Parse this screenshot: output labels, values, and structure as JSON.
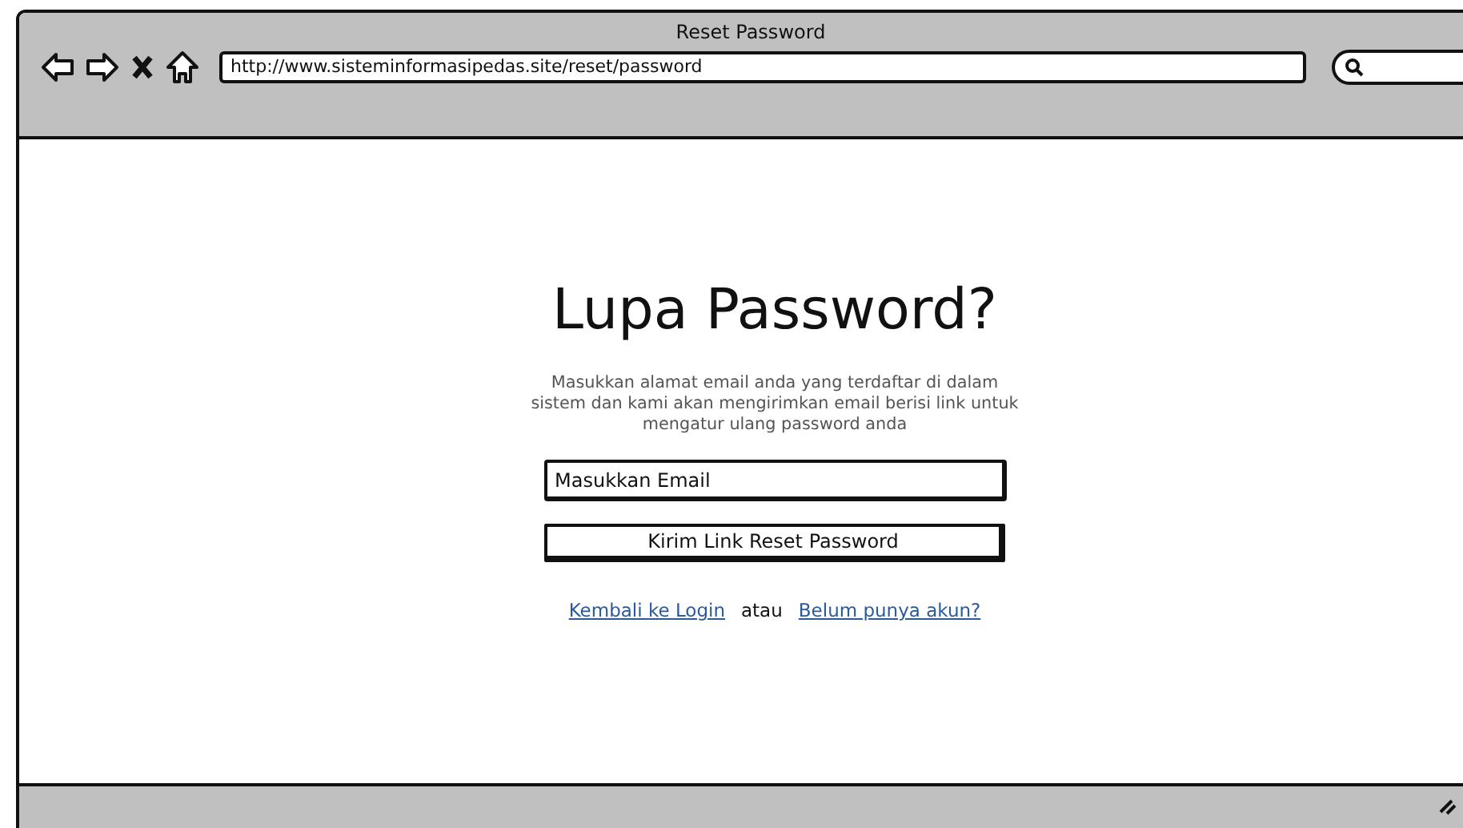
{
  "window": {
    "title": "Reset Password"
  },
  "toolbar": {
    "url": "http://www.sisteminformasipedas.site/reset/password"
  },
  "heading": "Lupa Password?",
  "description": "Masukkan alamat email anda yang terdaftar di dalam sistem dan kami akan mengirimkan email berisi link untuk mengatur ulang password anda",
  "email_field": {
    "placeholder": "Masukkan Email"
  },
  "submit_button": "Kirim Link Reset Password",
  "footer_links": [
    {
      "kind": "link",
      "text": "Kembali ke Login"
    },
    {
      "kind": "text",
      "text": "atau"
    },
    {
      "kind": "link",
      "text": "Belum punya akun?"
    }
  ]
}
